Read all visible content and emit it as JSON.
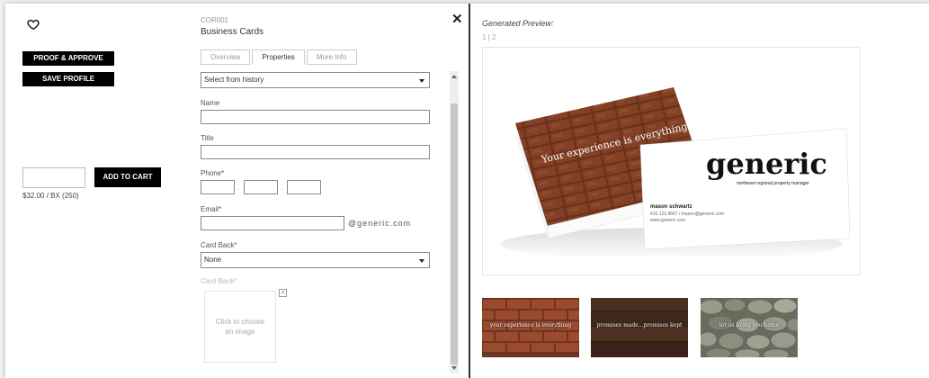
{
  "left": {
    "proof_label": "PROOF & APPROVE",
    "save_label": "SAVE PROFILE",
    "qty_value": "",
    "add_to_cart_label": "ADD TO CART",
    "price": "$32.00 / BX (250)"
  },
  "product": {
    "code": "COR001",
    "name": "Business Cards"
  },
  "tabs": [
    {
      "label": "Overview",
      "active": false
    },
    {
      "label": "Properties",
      "active": true
    },
    {
      "label": "More Info",
      "active": false
    }
  ],
  "form": {
    "history_select": "Select from history",
    "name_label": "Name",
    "name_value": "",
    "title_label": "Title",
    "title_value": "",
    "phone_label": "Phone*",
    "email_label": "Email*",
    "email_suffix": "@generic.com",
    "card_back_label": "Card Back*",
    "card_back_value": "None",
    "card_back_image_label": "Card Back*",
    "choose_image_text": "Click to choose an image"
  },
  "preview": {
    "title": "Generated Preview:",
    "pages": "1 | 2",
    "brand": "generic",
    "tagline": "northeast regional property manager",
    "person": "mason schwartz",
    "contact": "410.123.4567 / mason@generic.com",
    "website": "www.generic.com",
    "stack_text": "Your experience is everything"
  },
  "thumbnails": [
    {
      "caption": "your experience is everything"
    },
    {
      "caption": "promises made...promises kept"
    },
    {
      "caption": "let us bring you home"
    }
  ],
  "colors": {
    "accent": "#000000",
    "divider": "#333333"
  }
}
